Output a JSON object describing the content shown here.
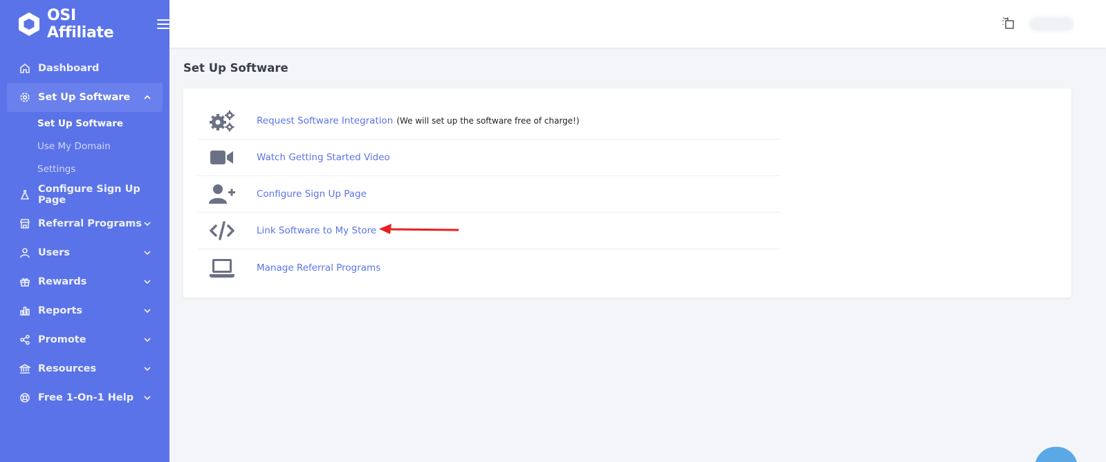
{
  "brand": {
    "name": "OSI Affiliate"
  },
  "sidebar": {
    "items": [
      {
        "label": "Dashboard"
      },
      {
        "label": "Set Up Software",
        "sub": [
          {
            "label": "Set Up Software"
          },
          {
            "label": "Use My Domain"
          },
          {
            "label": "Settings"
          }
        ]
      },
      {
        "label": "Configure Sign Up Page"
      },
      {
        "label": "Referral Programs"
      },
      {
        "label": "Users"
      },
      {
        "label": "Rewards"
      },
      {
        "label": "Reports"
      },
      {
        "label": "Promote"
      },
      {
        "label": "Resources"
      },
      {
        "label": "Free 1-On-1 Help"
      }
    ]
  },
  "main": {
    "title": "Set Up Software",
    "rows": [
      {
        "label": "Request Software Integration",
        "note": "(We will set up the software free of charge!)",
        "icon": "gears-icon"
      },
      {
        "label": "Watch Getting Started Video",
        "icon": "video-camera-icon"
      },
      {
        "label": "Configure Sign Up Page",
        "icon": "user-plus-icon"
      },
      {
        "label": "Link Software to My Store",
        "icon": "code-icon"
      },
      {
        "label": "Manage Referral Programs",
        "icon": "laptop-icon"
      }
    ]
  },
  "colors": {
    "sidebar": "#5b73e8",
    "link": "#5b73e8",
    "icon": "#6b7185",
    "annotation": "#e82020"
  }
}
